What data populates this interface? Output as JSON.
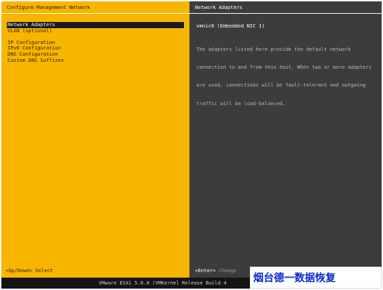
{
  "left_pane": {
    "title": "Configure Management Network",
    "menu": [
      "Network Adapters",
      "VLAN (optional)",
      "IP Configuration",
      "IPv6 Configuration",
      "DNS Configuration",
      "Custom DNS Suffixes"
    ],
    "selected_item": "Network Adapters",
    "hint_key": "<Up/Down>",
    "hint_action": "Select"
  },
  "right_pane": {
    "title": "Network Adapters",
    "adapter": "vmnic0 (Embedded NIC 1)",
    "description_lines": [
      "The adapters listed here provide the default network",
      "connection to and from this host. When two or more adapters",
      "are used, connections will be fault-tolerant and outgoing",
      "traffic will be load-balanced."
    ],
    "hint_key": "<Enter>",
    "hint_action": "Change"
  },
  "status_bar": {
    "text": "VMware ESXi 5.0.0 (VMKernel Release Build 4"
  },
  "watermark": {
    "text": "烟台德一数据恢复"
  },
  "colors": {
    "left_pane_bg": "#f7b500",
    "right_pane_bg": "#3c3c3c",
    "selection_bg": "#1a1a1a",
    "watermark_text": "#0a2ccf"
  }
}
